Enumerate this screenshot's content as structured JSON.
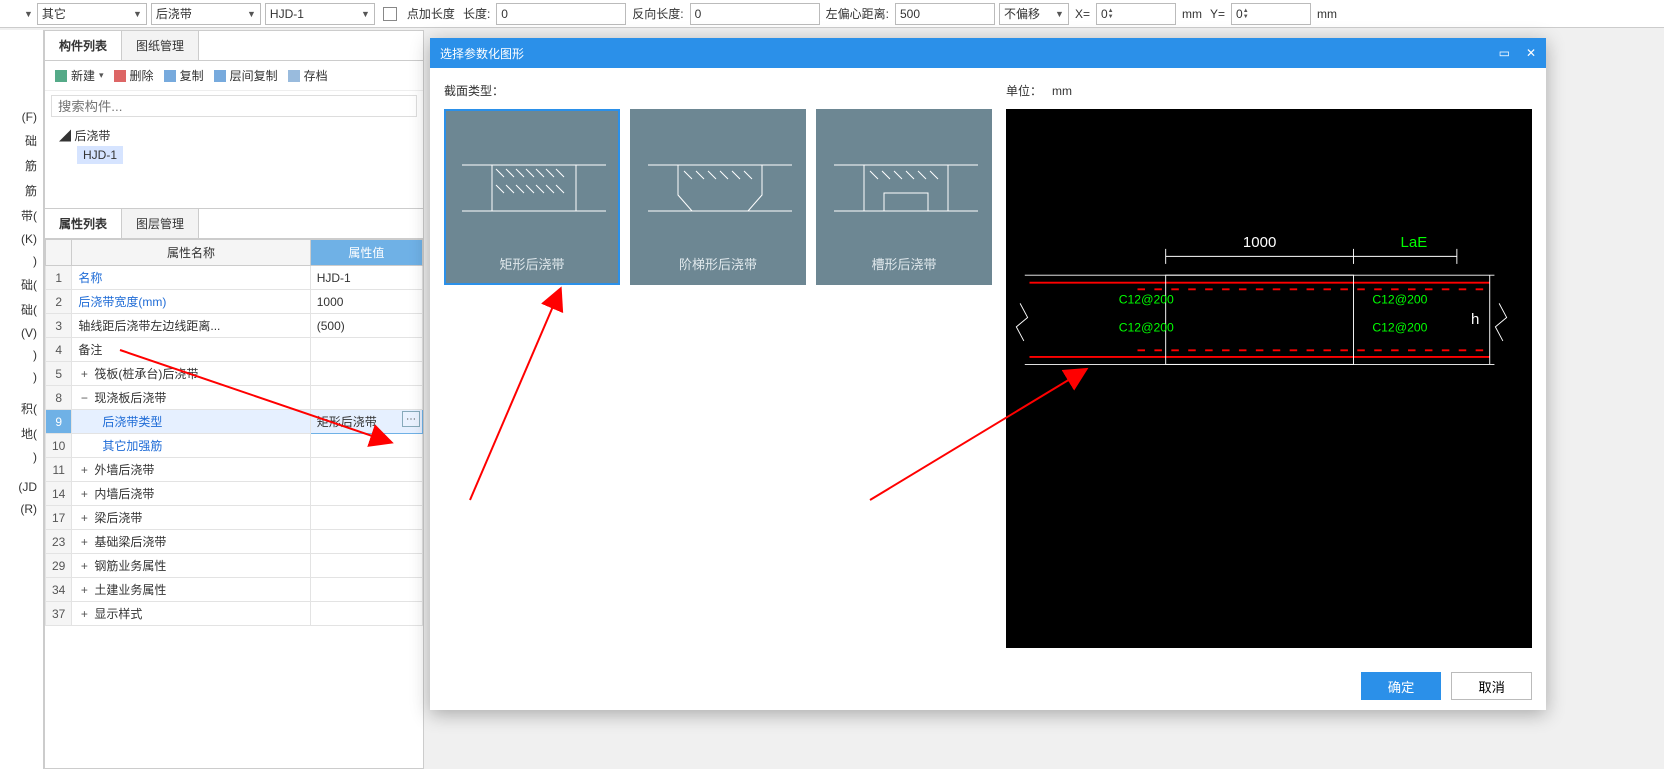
{
  "topbar": {
    "dd1": "其它",
    "dd2": "后浇带",
    "dd3": "HJD-1",
    "chk_label": "点加长度",
    "len_label": "长度:",
    "len_val": "0",
    "revlen_label": "反向长度:",
    "revlen_val": "0",
    "offset_label": "左偏心距离:",
    "offset_val": "500",
    "shift": "不偏移",
    "x_label": "X=",
    "x_val": "0",
    "mm1": "mm",
    "y_label": "Y=",
    "y_val": "0",
    "mm2": "mm"
  },
  "leftstrip": [
    "(F)",
    "础",
    "筋",
    "筋",
    "带(",
    "(K)",
    ")",
    "础(",
    "础(",
    "(V)",
    ")",
    ")",
    "",
    "积(",
    "地(",
    ")",
    "",
    "(JD",
    "(R)"
  ],
  "panel": {
    "tabs": {
      "a": "构件列表",
      "b": "图纸管理"
    },
    "toolbar": {
      "new": "新建",
      "del": "删除",
      "copy": "复制",
      "floorcopy": "层间复制",
      "archive": "存档"
    },
    "search_placeholder": "搜索构件...",
    "tree": {
      "root": "后浇带",
      "child": "HJD-1"
    },
    "propTabs": {
      "a": "属性列表",
      "b": "图层管理"
    },
    "propHeaders": {
      "name": "属性名称",
      "value": "属性值"
    },
    "rows": [
      {
        "n": "1",
        "name": "名称",
        "value": "HJD-1",
        "link": true
      },
      {
        "n": "2",
        "name": "后浇带宽度(mm)",
        "value": "1000",
        "link": true
      },
      {
        "n": "3",
        "name": "轴线距后浇带左边线距离...",
        "value": "(500)"
      },
      {
        "n": "4",
        "name": "备注",
        "value": ""
      },
      {
        "n": "5",
        "name": "筏板(桩承台)后浇带",
        "value": "",
        "exp": "+"
      },
      {
        "n": "8",
        "name": "现浇板后浇带",
        "value": "",
        "exp": "−"
      },
      {
        "n": "9",
        "name": "后浇带类型",
        "value": "矩形后浇带",
        "link": true,
        "indent": true,
        "selected": true,
        "ellipsis": true
      },
      {
        "n": "10",
        "name": "其它加强筋",
        "value": "",
        "link": true,
        "indent": true
      },
      {
        "n": "11",
        "name": "外墙后浇带",
        "value": "",
        "exp": "+"
      },
      {
        "n": "14",
        "name": "内墙后浇带",
        "value": "",
        "exp": "+"
      },
      {
        "n": "17",
        "name": "梁后浇带",
        "value": "",
        "exp": "+"
      },
      {
        "n": "23",
        "name": "基础梁后浇带",
        "value": "",
        "exp": "+"
      },
      {
        "n": "29",
        "name": "钢筋业务属性",
        "value": "",
        "exp": "+"
      },
      {
        "n": "34",
        "name": "土建业务属性",
        "value": "",
        "exp": "+"
      },
      {
        "n": "37",
        "name": "显示样式",
        "value": "",
        "exp": "+"
      }
    ]
  },
  "dialog": {
    "title": "选择参数化图形",
    "section_label": "截面类型：",
    "cards": [
      {
        "caption": "矩形后浇带",
        "selected": true
      },
      {
        "caption": "阶梯形后浇带",
        "selected": false
      },
      {
        "caption": "槽形后浇带",
        "selected": false
      }
    ],
    "unit_label": "单位：",
    "unit_value": "mm",
    "preview": {
      "dim_top": "1000",
      "dim_right": "LaE",
      "h": "h",
      "rebar": "C12@200"
    },
    "ok": "确定",
    "cancel": "取消"
  }
}
